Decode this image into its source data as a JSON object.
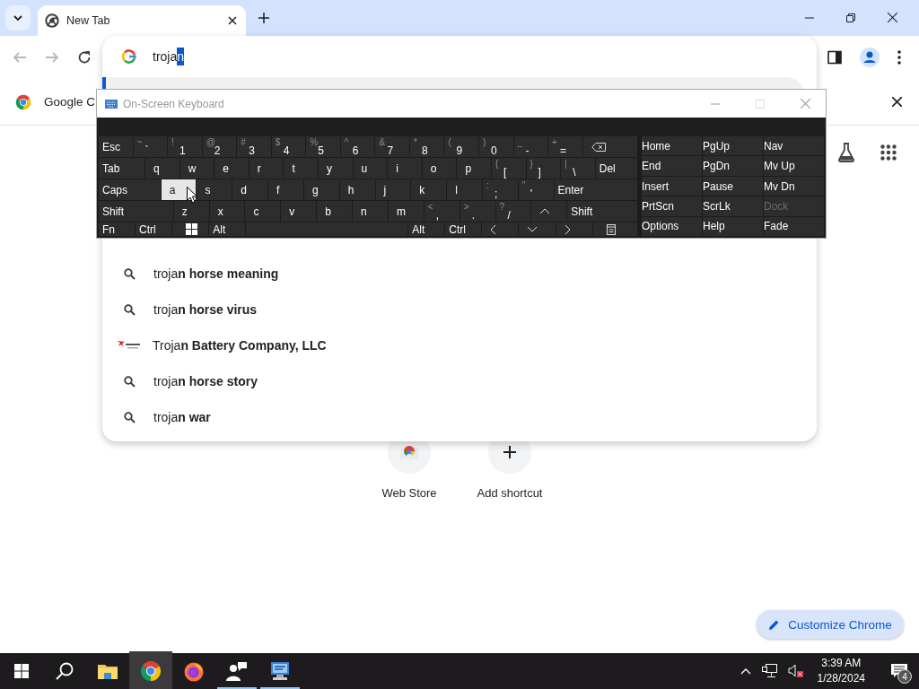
{
  "tabstrip": {
    "tabs": [
      {
        "title": "New Tab",
        "selected": true
      }
    ]
  },
  "toolbar": {
    "nav_buttons": [
      {
        "kind": "back",
        "disabled": true
      },
      {
        "kind": "forward",
        "disabled": true
      },
      {
        "kind": "reload",
        "disabled": false
      }
    ]
  },
  "omnibox": {
    "text": "troja",
    "selected_text": "n"
  },
  "suggestions": [
    {
      "kind": "search",
      "text": "troja**n horse meaning**"
    },
    {
      "kind": "search",
      "text": "troja**n horse virus**"
    },
    {
      "kind": "entity",
      "text": "Troja**n Battery Company, LLC**"
    },
    {
      "kind": "search",
      "text": "troja**n horse story**"
    },
    {
      "kind": "search",
      "text": "troja**n war**"
    }
  ],
  "infobar": {
    "text": "Google C"
  },
  "new_tab_page": {
    "shortcuts": [
      {
        "kind": "web-store",
        "label": "Web Store"
      },
      {
        "kind": "add",
        "label": "Add shortcut"
      }
    ],
    "customize_button": "Customize Chrome"
  },
  "on_screen_keyboard": {
    "title": "On-Screen Keyboard",
    "rows": [
      [
        {
          "kind": "text",
          "label": "Esc",
          "hover": false
        },
        {
          "kind": "text",
          "shift": "~",
          "label": "`",
          "hover": false
        },
        {
          "kind": "text",
          "shift": "!",
          "label": "1",
          "hover": false
        },
        {
          "kind": "text",
          "shift": "@",
          "label": "2",
          "hover": false
        },
        {
          "kind": "text",
          "shift": "#",
          "label": "3",
          "hover": false
        },
        {
          "kind": "text",
          "shift": "$",
          "label": "4",
          "hover": false
        },
        {
          "kind": "text",
          "shift": "%",
          "label": "5",
          "hover": false
        },
        {
          "kind": "text",
          "shift": "^",
          "label": "6",
          "hover": false
        },
        {
          "kind": "text",
          "shift": "&",
          "label": "7",
          "hover": false
        },
        {
          "kind": "text",
          "shift": "*",
          "label": "8",
          "hover": false
        },
        {
          "kind": "text",
          "shift": "(",
          "label": "9",
          "hover": false
        },
        {
          "kind": "text",
          "shift": ")",
          "label": "0",
          "hover": false
        },
        {
          "kind": "text",
          "shift": "_",
          "label": "-",
          "hover": false
        },
        {
          "kind": "text",
          "shift": "+",
          "label": "=",
          "hover": false
        },
        {
          "kind": "backspace",
          "hover": false
        }
      ],
      [
        {
          "kind": "text",
          "label": "Tab",
          "hover": false
        },
        {
          "kind": "text",
          "label": "q",
          "hover": false
        },
        {
          "kind": "text",
          "label": "w",
          "hover": false
        },
        {
          "kind": "text",
          "label": "e",
          "hover": false
        },
        {
          "kind": "text",
          "label": "r",
          "hover": false
        },
        {
          "kind": "text",
          "label": "t",
          "hover": false
        },
        {
          "kind": "text",
          "label": "y",
          "hover": false
        },
        {
          "kind": "text",
          "label": "u",
          "hover": false
        },
        {
          "kind": "text",
          "label": "i",
          "hover": false
        },
        {
          "kind": "text",
          "label": "o",
          "hover": false
        },
        {
          "kind": "text",
          "label": "p",
          "hover": false
        },
        {
          "kind": "text",
          "shift": "{",
          "label": "[",
          "hover": false
        },
        {
          "kind": "text",
          "shift": "}",
          "label": "]",
          "hover": false
        },
        {
          "kind": "text",
          "shift": "|",
          "label": "\\",
          "hover": false
        },
        {
          "kind": "text",
          "label": "Del",
          "hover": false
        }
      ],
      [
        {
          "kind": "text",
          "label": "Caps",
          "hover": false
        },
        {
          "kind": "text",
          "label": "a",
          "hover": true
        },
        {
          "kind": "text",
          "label": "s",
          "hover": false
        },
        {
          "kind": "text",
          "label": "d",
          "hover": false
        },
        {
          "kind": "text",
          "label": "f",
          "hover": false
        },
        {
          "kind": "text",
          "label": "g",
          "hover": false
        },
        {
          "kind": "text",
          "label": "h",
          "hover": false
        },
        {
          "kind": "text",
          "label": "j",
          "hover": false
        },
        {
          "kind": "text",
          "label": "k",
          "hover": false
        },
        {
          "kind": "text",
          "label": "l",
          "hover": false
        },
        {
          "kind": "text",
          "shift": ":",
          "label": ";",
          "hover": false
        },
        {
          "kind": "text",
          "shift": "\"",
          "label": "'",
          "hover": false
        },
        {
          "kind": "text",
          "label": "Enter",
          "hover": false
        }
      ],
      [
        {
          "kind": "text",
          "label": "Shift",
          "hover": false
        },
        {
          "kind": "text",
          "label": "z",
          "hover": false
        },
        {
          "kind": "text",
          "label": "x",
          "hover": false
        },
        {
          "kind": "text",
          "label": "c",
          "hover": false
        },
        {
          "kind": "text",
          "label": "v",
          "hover": false
        },
        {
          "kind": "text",
          "label": "b",
          "hover": false
        },
        {
          "kind": "text",
          "label": "n",
          "hover": false
        },
        {
          "kind": "text",
          "label": "m",
          "hover": false
        },
        {
          "kind": "text",
          "shift": "<",
          "label": ",",
          "hover": false
        },
        {
          "kind": "text",
          "shift": ">",
          "label": ".",
          "hover": false
        },
        {
          "kind": "text",
          "shift": "?",
          "label": "/",
          "hover": false
        },
        {
          "kind": "up",
          "hover": false
        },
        {
          "kind": "text",
          "label": "Shift",
          "hover": false
        }
      ],
      [
        {
          "kind": "text",
          "label": "Fn",
          "hover": false
        },
        {
          "kind": "text",
          "label": "Ctrl",
          "hover": false
        },
        {
          "kind": "windows",
          "hover": false
        },
        {
          "kind": "text",
          "label": "Alt",
          "hover": false
        },
        {
          "kind": "space",
          "hover": false
        },
        {
          "kind": "text",
          "label": "Alt",
          "hover": false
        },
        {
          "kind": "text",
          "label": "Ctrl",
          "hover": false
        },
        {
          "kind": "left",
          "hover": false
        },
        {
          "kind": "down",
          "hover": false
        },
        {
          "kind": "right",
          "hover": false
        },
        {
          "kind": "menu",
          "hover": false
        }
      ]
    ],
    "side_rows": [
      [
        {
          "label": "Home",
          "disabled": false
        },
        {
          "label": "PgUp",
          "disabled": false
        },
        {
          "label": "Nav",
          "disabled": false
        }
      ],
      [
        {
          "label": "End",
          "disabled": false
        },
        {
          "label": "PgDn",
          "disabled": false
        },
        {
          "label": "Mv Up",
          "disabled": false
        }
      ],
      [
        {
          "label": "Insert",
          "disabled": false
        },
        {
          "label": "Pause",
          "disabled": false
        },
        {
          "label": "Mv Dn",
          "disabled": false
        }
      ],
      [
        {
          "label": "PrtScn",
          "disabled": false
        },
        {
          "label": "ScrLk",
          "disabled": false
        },
        {
          "label": "Dock",
          "disabled": true
        }
      ],
      [
        {
          "label": "Options",
          "disabled": false
        },
        {
          "label": "Help",
          "disabled": false
        },
        {
          "label": "Fade",
          "disabled": false
        }
      ]
    ]
  },
  "taskbar": {
    "apps": [
      {
        "kind": "start",
        "running": false,
        "selected": false
      },
      {
        "kind": "search",
        "running": false,
        "selected": false
      },
      {
        "kind": "folder",
        "running": false,
        "selected": false
      },
      {
        "kind": "chrome",
        "running": true,
        "selected": true
      },
      {
        "kind": "firefox",
        "running": false,
        "selected": false
      },
      {
        "kind": "people",
        "running": true,
        "selected": false
      },
      {
        "kind": "computer",
        "running": true,
        "selected": false
      }
    ],
    "time": "3:39 AM",
    "date": "1/28/2024",
    "notifications": "4"
  }
}
